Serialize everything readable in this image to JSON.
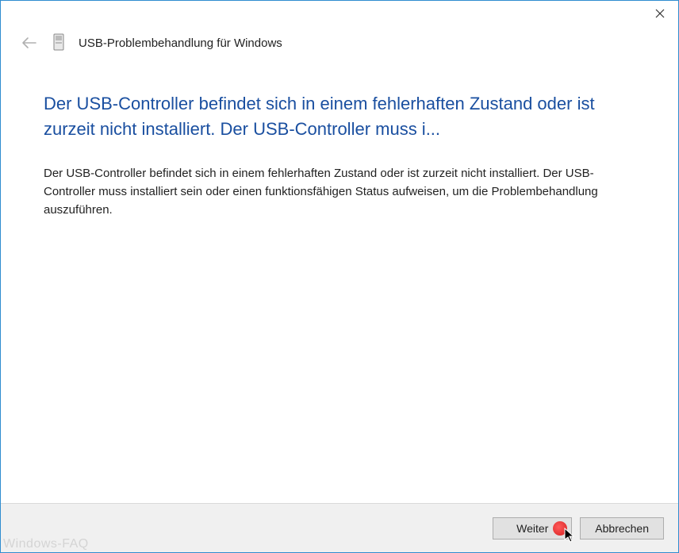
{
  "window": {
    "title": "USB-Problembehandlung für Windows"
  },
  "content": {
    "heading": "Der USB-Controller befindet sich in einem fehlerhaften Zustand oder ist zurzeit nicht installiert. Der USB-Controller muss i...",
    "body": "Der USB-Controller befindet sich in einem fehlerhaften Zustand oder ist zurzeit nicht installiert. Der USB-Controller muss installiert sein oder einen funktionsfähigen Status aufweisen, um die Problembehandlung auszuführen."
  },
  "footer": {
    "next_label": "Weiter",
    "cancel_label": "Abbrechen"
  },
  "watermark": "Windows-FAQ"
}
